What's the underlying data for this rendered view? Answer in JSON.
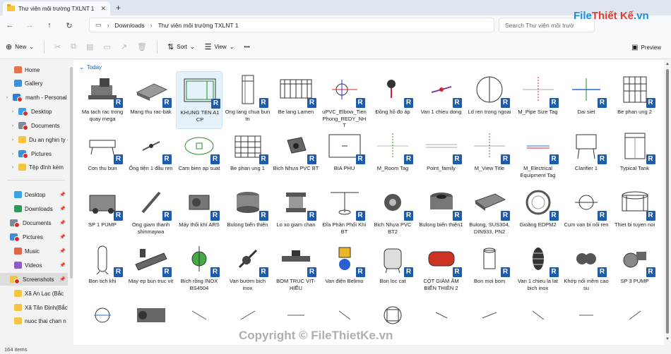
{
  "tab": {
    "title": "Thư viện môi trường TXLNT 1",
    "close": "✕",
    "new": "+"
  },
  "address": {
    "crumbs": [
      "Downloads",
      "Thư viện môi trường TXLNT 1"
    ]
  },
  "search": {
    "placeholder": "Search Thư viện môi trườ"
  },
  "logo": {
    "part1": "File",
    "part2": "Thiết Kế",
    "part3": ".vn"
  },
  "toolbar": {
    "new_label": "New",
    "sort_label": "Sort",
    "view_label": "View",
    "more_label": "•••",
    "preview_label": "Preview"
  },
  "sidebar": {
    "items": [
      {
        "label": "Home",
        "icon": "home-icon",
        "color": "#e8734a"
      },
      {
        "label": "Gallery",
        "icon": "gallery-icon",
        "color": "#3d8fd8"
      },
      {
        "label": "manh - Personal",
        "icon": "cloud-icon",
        "color": "#2f7fd3"
      },
      {
        "label": "Desktop",
        "icon": "desktop-icon",
        "color": "#3aa0e8"
      },
      {
        "label": "Documents",
        "icon": "documents-icon",
        "color": "#7a8c99"
      },
      {
        "label": "Du an nghin ty - C",
        "icon": "folder-icon",
        "color": "#f4c542"
      },
      {
        "label": "Pictures",
        "icon": "pictures-icon",
        "color": "#3d8fd8"
      },
      {
        "label": "Tệp đính kèm",
        "icon": "folder-icon",
        "color": "#f4c542"
      },
      {
        "label": "Desktop",
        "icon": "desktop-icon",
        "color": "#3aa0e8"
      },
      {
        "label": "Downloads",
        "icon": "downloads-icon",
        "color": "#2b9a5a"
      },
      {
        "label": "Documents",
        "icon": "documents-icon",
        "color": "#7a8c99"
      },
      {
        "label": "Pictures",
        "icon": "pictures-icon",
        "color": "#3d8fd8"
      },
      {
        "label": "Music",
        "icon": "music-icon",
        "color": "#e2664a"
      },
      {
        "label": "Videos",
        "icon": "videos-icon",
        "color": "#8e5cc9"
      },
      {
        "label": "Screenshots",
        "icon": "folder-icon",
        "color": "#f4c542"
      },
      {
        "label": "Xã An Lạc (Bắc",
        "icon": "folder-icon",
        "color": "#f4c542"
      },
      {
        "label": "Xã Tân Định(Bắc",
        "icon": "folder-icon",
        "color": "#f4c542"
      },
      {
        "label": "nuoc thai chan n",
        "icon": "folder-icon",
        "color": "#f4c542"
      }
    ]
  },
  "content": {
    "group_label": "Today",
    "files": [
      {
        "label": "Ma tach rac trong quay mega",
        "revit": "R"
      },
      {
        "label": "Mang thu rac-bak",
        "revit": "R"
      },
      {
        "label": "KHUNG TEN A1 CP",
        "revit": "R"
      },
      {
        "label": "Ong lang chua bun tn",
        "revit": "R"
      },
      {
        "label": "Be lang Lamen",
        "revit": "R"
      },
      {
        "label": "uPVC_Elbow_Tien Phong_REDY_NHT",
        "revit": "R"
      },
      {
        "label": "Đồng hồ đo áp",
        "revit": "R"
      },
      {
        "label": "Van 1 chieu dong",
        "revit": "R"
      },
      {
        "label": "Ld ren trong ngoai",
        "revit": "R"
      },
      {
        "label": "M_Pipe Size Tag",
        "revit": "R"
      },
      {
        "label": "Dai siet",
        "revit": "R"
      },
      {
        "label": "Be phan ung 2",
        "revit": "R"
      },
      {
        "label": "Con thu bun",
        "revit": "R"
      },
      {
        "label": "Ống tiện 1 đầu ren",
        "revit": "R"
      },
      {
        "label": "Cam bien ap suat",
        "revit": "R"
      },
      {
        "label": "Be phan ung 1",
        "revit": "R"
      },
      {
        "label": "Bich Nhựa PVC BT",
        "revit": "R"
      },
      {
        "label": "BIA PHU",
        "revit": "R"
      },
      {
        "label": "M_Room Tag",
        "revit": "R"
      },
      {
        "label": "Point_family",
        "revit": "R"
      },
      {
        "label": "M_View Title",
        "revit": "R"
      },
      {
        "label": "M_Electrical Equipment Tag",
        "revit": "R"
      },
      {
        "label": "Clarifier 1",
        "revit": "R"
      },
      {
        "label": "Typical Tank",
        "revit": "R"
      },
      {
        "label": "SP 1 PUMP",
        "revit": "R"
      },
      {
        "label": "Ong giam thanh shinmaywa",
        "revit": "R"
      },
      {
        "label": "Máy thổi khí ARS",
        "revit": "R"
      },
      {
        "label": "Bulong biển thiên",
        "revit": "R"
      },
      {
        "label": "Lo xo giam chan",
        "revit": "R"
      },
      {
        "label": "Đĩa Phân Phối Khí BT",
        "revit": "R"
      },
      {
        "label": "Bich Nhựa PVC BT2",
        "revit": "R"
      },
      {
        "label": "Bulong biến thiện1",
        "revit": "R"
      },
      {
        "label": "Bulong, SUS304, DIN933, PN2",
        "revit": "R"
      },
      {
        "label": "Gioăng EDPM2",
        "revit": "R"
      },
      {
        "label": "Cụm van bi nối ren",
        "revit": "R"
      },
      {
        "label": "Thiet bi tuyen noi",
        "revit": "R"
      },
      {
        "label": "Bon tich khi",
        "revit": "R"
      },
      {
        "label": "May ep bun truc vit",
        "revit": "R"
      },
      {
        "label": "Bích rồng INOX BS4504",
        "revit": "R"
      },
      {
        "label": "Van bướm bich inox",
        "revit": "R"
      },
      {
        "label": "BOM TRUC VIT-HIẾU",
        "revit": "R"
      },
      {
        "label": "Van điện Belimo",
        "revit": "R"
      },
      {
        "label": "Bon loc cat",
        "revit": "R"
      },
      {
        "label": "CỘT GIẢM ÂM BIẾN THIÊN 2",
        "revit": "R"
      },
      {
        "label": "Bon moi bom",
        "revit": "R"
      },
      {
        "label": "Van 1 chieu la lat bich inox",
        "revit": "R"
      },
      {
        "label": "Khớp nối mềm cao su",
        "revit": "R"
      },
      {
        "label": "SP 3 PUMP",
        "revit": "R"
      },
      {
        "label": "",
        "revit": ""
      },
      {
        "label": "",
        "revit": ""
      },
      {
        "label": "",
        "revit": ""
      },
      {
        "label": "",
        "revit": ""
      },
      {
        "label": "",
        "revit": ""
      },
      {
        "label": "",
        "revit": ""
      },
      {
        "label": "",
        "revit": ""
      },
      {
        "label": "",
        "revit": ""
      },
      {
        "label": "",
        "revit": ""
      },
      {
        "label": "",
        "revit": ""
      },
      {
        "label": "",
        "revit": ""
      },
      {
        "label": "",
        "revit": ""
      }
    ]
  },
  "status": {
    "count": "164 items"
  },
  "watermark": "Copyright © FileThietKe.vn",
  "colors": {
    "accent": "#1a5fb4",
    "revit_badge": "#1e5ba8",
    "selection": "#e5f1fb"
  }
}
